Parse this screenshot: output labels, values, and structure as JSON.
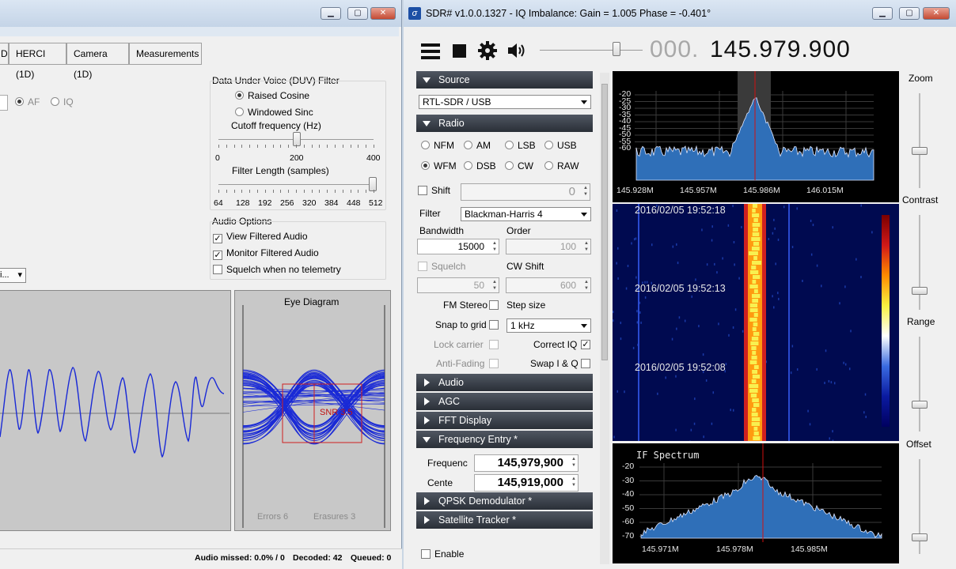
{
  "left": {
    "tabs": [
      "D",
      "HERCI (1D)",
      "Camera (1D)",
      "Measurements"
    ],
    "radio_af": "AF",
    "radio_iq": "IQ",
    "duv_title": "Data Under Voice (DUV) Filter",
    "raised_cosine": "Raised Cosine",
    "windowed_sinc": "Windowed Sinc",
    "cutoff_label": "Cutoff frequency (Hz)",
    "cutoff_ticks": [
      "0",
      "200",
      "400"
    ],
    "length_label": "Filter Length (samples)",
    "length_ticks": [
      "64",
      "128",
      "192",
      "256",
      "320",
      "384",
      "448",
      "512"
    ],
    "audio_title": "Audio Options",
    "view_filtered": "View Filtered Audio",
    "monitor_filtered": "Monitor Filtered Audio",
    "squelch_tele": "Squelch when no telemetry",
    "dropdown_trunc": "i...",
    "eye_title": "Eye Diagram",
    "snr": "SNR 3.5",
    "errors": "Errors   6",
    "erasures": "Erasures   3",
    "status": {
      "audio_missed": "Audio missed: 0.0% / 0",
      "decoded": "Decoded: 42",
      "queued": "Queued: 0"
    }
  },
  "sdr": {
    "title": "SDR# v1.0.0.1327 - IQ Imbalance: Gain = 1.005 Phase = -0.401°",
    "freq_prefix": "000.",
    "freq_main": "145.979.900",
    "source_section": "Source",
    "source_combo": "RTL-SDR / USB",
    "radio_section": "Radio",
    "modes": [
      "NFM",
      "AM",
      "LSB",
      "USB",
      "WFM",
      "DSB",
      "CW",
      "RAW"
    ],
    "shift_label": "Shift",
    "shift_value": "0",
    "filter_label": "Filter",
    "filter_value": "Blackman-Harris 4",
    "bandwidth_label": "Bandwidth",
    "order_label": "Order",
    "bandwidth_value": "15000",
    "order_value": "100",
    "squelch_label": "Squelch",
    "cwshift_label": "CW Shift",
    "squelch_value": "50",
    "cwshift_value": "600",
    "fm_stereo": "FM Stereo",
    "step_size": "Step size",
    "snap_grid": "Snap to grid",
    "step_value": "1 kHz",
    "lock_carrier": "Lock carrier",
    "correct_iq": "Correct IQ",
    "anti_fading": "Anti-Fading",
    "swap_iq": "Swap I & Q",
    "audio_section": "Audio",
    "agc_section": "AGC",
    "fft_section": "FFT Display",
    "freq_entry_section": "Frequency Entry *",
    "frequency_label": "Frequenc",
    "frequency_value": "145,979,900",
    "center_label": "Cente",
    "center_value": "145,919,000",
    "qpsk_section": "QPSK Demodulator *",
    "sat_section": "Satellite Tracker *",
    "enable_label": "Enable",
    "zoom_label": "Zoom",
    "contrast_label": "Contrast",
    "range_label": "Range",
    "offset_label": "Offset",
    "spectrum": {
      "y_ticks": [
        "-20",
        "-25",
        "-30",
        "-35",
        "-40",
        "-45",
        "-50",
        "-55",
        "-60"
      ],
      "x_ticks": [
        "145.928M",
        "145.957M",
        "145.986M",
        "146.015M"
      ]
    },
    "waterfall": {
      "timestamps": [
        "2016/02/05 19:52:18",
        "2016/02/05 19:52:13",
        "2016/02/05 19:52:08"
      ]
    },
    "if_spectrum": {
      "title": "IF Spectrum",
      "y_ticks": [
        "-20",
        "-30",
        "-40",
        "-50",
        "-60",
        "-70"
      ],
      "x_ticks": [
        "145.971M",
        "145.978M",
        "145.985M"
      ]
    }
  },
  "colors": {
    "spectrum_fill": "#2f6fb8",
    "center_line": "#d01010",
    "eye_trace": "#1a2ad6",
    "waterfall_bg": "#000a50"
  }
}
